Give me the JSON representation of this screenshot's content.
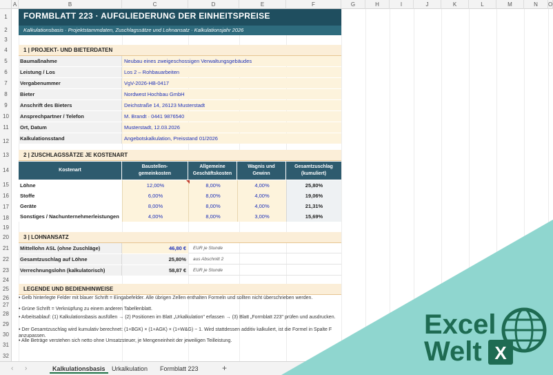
{
  "columns": [
    "A",
    "B",
    "C",
    "D",
    "E",
    "F",
    "G",
    "H",
    "I",
    "J",
    "K",
    "L",
    "M",
    "N",
    "O"
  ],
  "rows": [
    "1",
    "2",
    "3",
    "4",
    "5",
    "6",
    "7",
    "8",
    "9",
    "10",
    "11",
    "12",
    "13",
    "14",
    "15",
    "16",
    "17",
    "18",
    "19",
    "20",
    "21",
    "22",
    "23",
    "24",
    "25",
    "26",
    "27",
    "28",
    "29",
    "30",
    "31",
    "32"
  ],
  "title": "FORMBLATT 223  ·  AUFGLIEDERUNG DER EINHEITSPREISE",
  "subtitle": "Kalkulationsbasis  ·  Projektstammdaten, Zuschlagssätze und Lohnansatz  ·  Kalkulationsjahr 2026",
  "section1": {
    "title": "1  |  PROJEKT- UND BIETERDATEN",
    "rows": [
      {
        "label": "Baumaßnahme",
        "value": "Neubau eines zweigeschossigen Verwaltungsgebäudes"
      },
      {
        "label": "Leistung / Los",
        "value": "Los 2 – Rohbauarbeiten"
      },
      {
        "label": "Vergabenummer",
        "value": "VgV-2026-HB-0417"
      },
      {
        "label": "Bieter",
        "value": "Nordwest Hochbau GmbH"
      },
      {
        "label": "Anschrift des Bieters",
        "value": "Deichstraße 14, 26123 Musterstadt"
      },
      {
        "label": "Ansprechpartner / Telefon",
        "value": "M. Brandt · 0441 9876540"
      },
      {
        "label": "Ort, Datum",
        "value": "Musterstadt, 12.03.2026"
      },
      {
        "label": "Kalkulationsstand",
        "value": "Angebotskalkulation, Preisstand 01/2026"
      }
    ]
  },
  "section2": {
    "title": "2  |  ZUSCHLAGSSÄTZE JE KOSTENART",
    "headers": [
      "Kostenart",
      "Baustellen-\ngemeinkosten",
      "Allgemeine\nGeschäftskosten",
      "Wagnis und\nGewinn",
      "Gesamtzuschlag\n(kumuliert)"
    ],
    "rows": [
      {
        "name": "Löhne",
        "bgk": "12,00%",
        "agk": "8,00%",
        "wg": "4,00%",
        "total": "25,80%"
      },
      {
        "name": "Stoffe",
        "bgk": "6,00%",
        "agk": "8,00%",
        "wg": "4,00%",
        "total": "19,06%"
      },
      {
        "name": "Geräte",
        "bgk": "8,00%",
        "agk": "8,00%",
        "wg": "4,00%",
        "total": "21,31%"
      },
      {
        "name": "Sonstiges / Nachunternehmerleistungen",
        "bgk": "4,00%",
        "agk": "8,00%",
        "wg": "3,00%",
        "total": "15,69%"
      }
    ]
  },
  "section3": {
    "title": "3  |  LOHNANSATZ",
    "rows": [
      {
        "label": "Mittellohn ASL (ohne Zuschläge)",
        "value": "46,80 €",
        "note": "EUR je Stunde"
      },
      {
        "label": "Gesamtzuschlag auf Löhne",
        "value": "25,80%",
        "note": "aus Abschnitt 2"
      },
      {
        "label": "Verrechnungslohn (kalkulatorisch)",
        "value": "58,87 €",
        "note": "EUR je Stunde"
      }
    ]
  },
  "section4": {
    "title": "LEGENDE UND BEDIENHINWEISE",
    "lines": [
      "•  Gelb hinterlegte Felder mit blauer Schrift = Eingabefelder. Alle übrigen Zellen enthalten Formeln und sollten nicht überschrieben werden.",
      "•  Grüne Schrift = Verknüpfung zu einem anderen Tabellenblatt.",
      "•  Arbeitsablauf: (1) Kalkulationsbasis ausfüllen  →  (2) Positionen im Blatt „Urkalkulation\" erfassen  →  (3) Blatt „Formblatt 223\" prüfen und ausdrucken.",
      "•  Der Gesamtzuschlag wird kumulativ berechnet: (1+BGK) × (1+AGK) × (1+W&G) − 1. Wird stattdessen additiv kalkuliert, ist die Formel in Spalte F anzupassen.",
      "•  Alle Beträge verstehen sich netto ohne Umsatzsteuer, je Mengeneinheit der jeweiligen Teilleistung."
    ]
  },
  "tabs": [
    "Kalkulationsbasis",
    "Urkalkulation",
    "Formblatt 223"
  ],
  "active_tab": "Kalkulationsbasis",
  "brand": {
    "line1": "Excel",
    "line2": "Welt",
    "badge": "X"
  },
  "colors": {
    "title": "#1f4e5f",
    "section": "#fbeed8",
    "input": "#fdf3dc",
    "input_text": "#1c2fb8",
    "brand": "#1e7145",
    "overlay": "#8fd6cf"
  }
}
